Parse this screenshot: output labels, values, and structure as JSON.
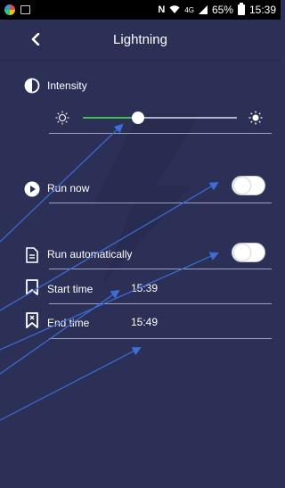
{
  "status_bar": {
    "battery": "65%",
    "time": "15:39",
    "network": "4G"
  },
  "header": {
    "title": "Lightning"
  },
  "intensity": {
    "label": "Intensity",
    "value_fraction": 0.42
  },
  "run_now": {
    "label": "Run now",
    "enabled": false
  },
  "run_automatically": {
    "label": "Run automatically",
    "enabled": false
  },
  "start_time": {
    "label": "Start time",
    "value": "15:39"
  },
  "end_time": {
    "label": "End time",
    "value": "15:49"
  },
  "colors": {
    "background": "#2c3057",
    "slider_active": "#3fbf4f",
    "annotation": "#3a6fd8"
  },
  "icons": {
    "back": "chevron-left-icon",
    "intensity": "contrast-icon",
    "run_now": "play-icon",
    "run_automatically": "document-icon",
    "start_time": "bookmark-icon",
    "end_time": "bookmark-x-icon"
  }
}
